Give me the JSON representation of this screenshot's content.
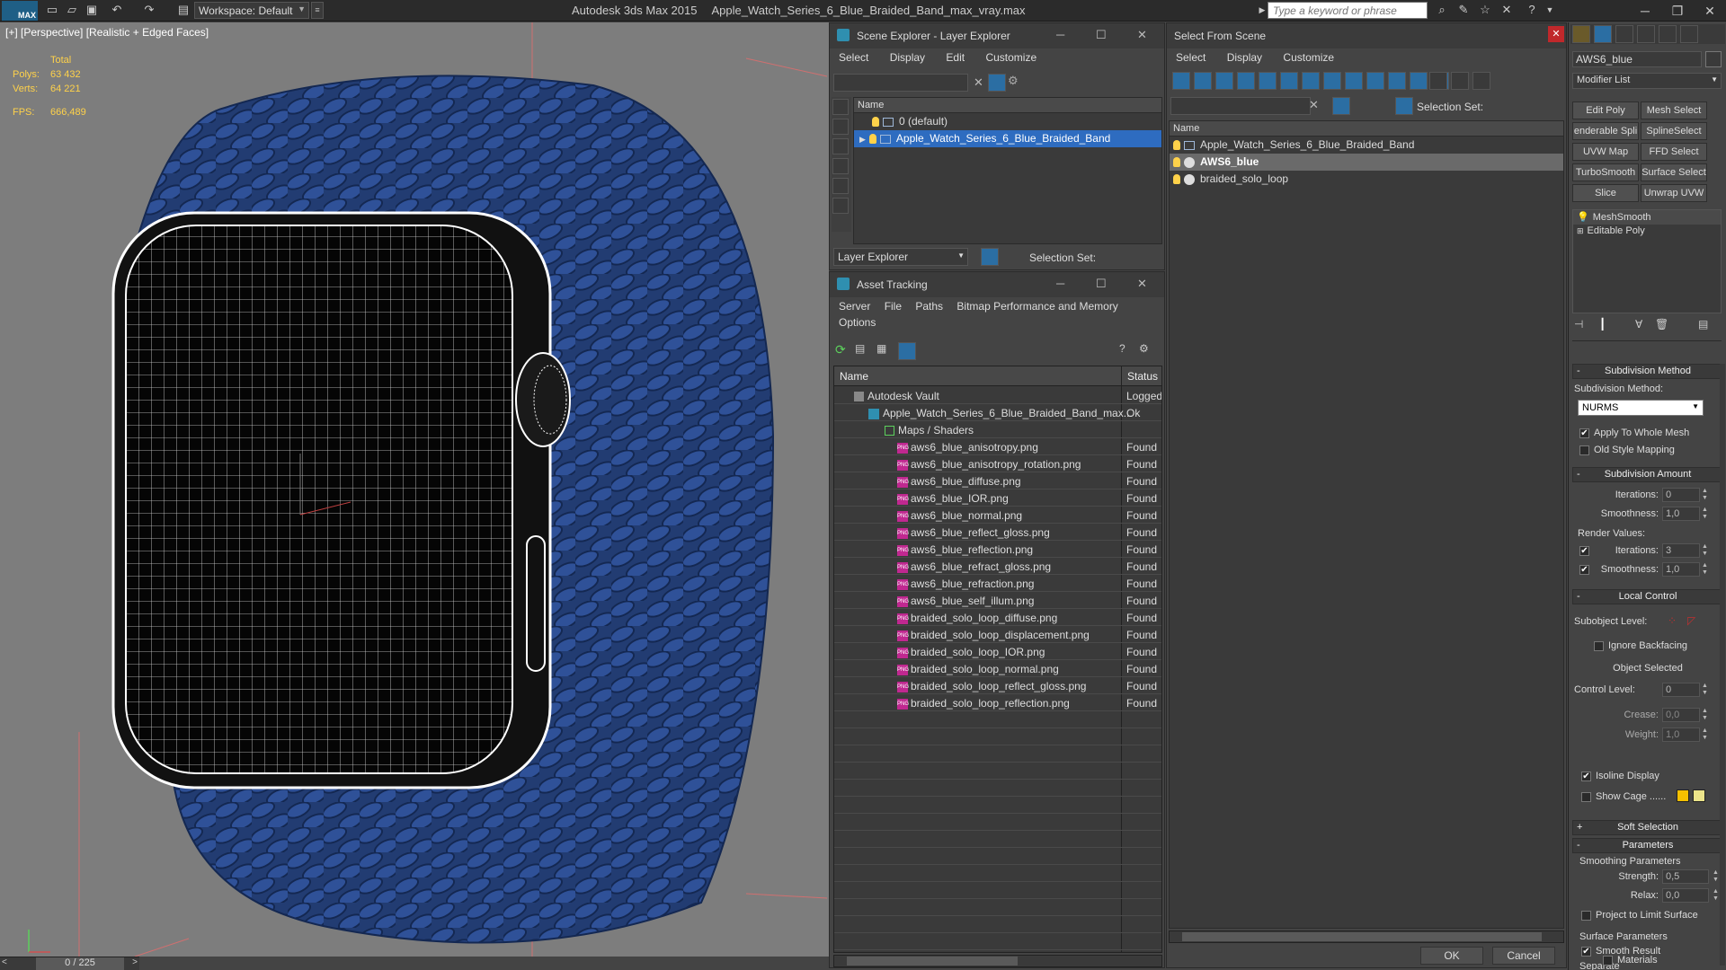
{
  "app": {
    "logo": "MAX",
    "workspace": "Workspace: Default",
    "name": "Autodesk 3ds Max  2015",
    "file": "Apple_Watch_Series_6_Blue_Braided_Band_max_vray.max",
    "search_placeholder": "Type a keyword or phrase"
  },
  "viewport": {
    "label": "[+] [Perspective] [Realistic + Edged Faces]",
    "stats": {
      "total": "Total",
      "polys_label": "Polys:",
      "polys": "63 432",
      "verts_label": "Verts:",
      "verts": "64 221",
      "fps_label": "FPS:",
      "fps": "666,489"
    },
    "timeline": {
      "frame": "0 / 225",
      "left": "<",
      "right": ">"
    }
  },
  "scene_explorer": {
    "title": "Scene Explorer - Layer Explorer",
    "menu": [
      "Select",
      "Display",
      "Edit",
      "Customize"
    ],
    "col_name": "Name",
    "rows": [
      "0 (default)",
      "Apple_Watch_Series_6_Blue_Braided_Band"
    ],
    "footer_dropdown": "Layer Explorer",
    "selection_set": "Selection Set:"
  },
  "asset_tracking": {
    "title": "Asset Tracking",
    "menu": [
      "Server",
      "File",
      "Paths",
      "Bitmap Performance and Memory"
    ],
    "menu2": "Options",
    "col_name": "Name",
    "col_status": "Status",
    "rows": [
      {
        "name": "Autodesk Vault",
        "status": "Logged",
        "level": 1,
        "icon": "vault"
      },
      {
        "name": "Apple_Watch_Series_6_Blue_Braided_Band_max...",
        "status": "Ok",
        "level": 2,
        "icon": "max"
      },
      {
        "name": "Maps / Shaders",
        "status": "",
        "level": 3,
        "icon": "folder"
      },
      {
        "name": "aws6_blue_anisotropy.png",
        "status": "Found",
        "level": 4,
        "icon": "png"
      },
      {
        "name": "aws6_blue_anisotropy_rotation.png",
        "status": "Found",
        "level": 4,
        "icon": "png"
      },
      {
        "name": "aws6_blue_diffuse.png",
        "status": "Found",
        "level": 4,
        "icon": "png"
      },
      {
        "name": "aws6_blue_IOR.png",
        "status": "Found",
        "level": 4,
        "icon": "png"
      },
      {
        "name": "aws6_blue_normal.png",
        "status": "Found",
        "level": 4,
        "icon": "png"
      },
      {
        "name": "aws6_blue_reflect_gloss.png",
        "status": "Found",
        "level": 4,
        "icon": "png"
      },
      {
        "name": "aws6_blue_reflection.png",
        "status": "Found",
        "level": 4,
        "icon": "png"
      },
      {
        "name": "aws6_blue_refract_gloss.png",
        "status": "Found",
        "level": 4,
        "icon": "png"
      },
      {
        "name": "aws6_blue_refraction.png",
        "status": "Found",
        "level": 4,
        "icon": "png"
      },
      {
        "name": "aws6_blue_self_illum.png",
        "status": "Found",
        "level": 4,
        "icon": "png"
      },
      {
        "name": "braided_solo_loop_diffuse.png",
        "status": "Found",
        "level": 4,
        "icon": "png"
      },
      {
        "name": "braided_solo_loop_displacement.png",
        "status": "Found",
        "level": 4,
        "icon": "png"
      },
      {
        "name": "braided_solo_loop_IOR.png",
        "status": "Found",
        "level": 4,
        "icon": "png"
      },
      {
        "name": "braided_solo_loop_normal.png",
        "status": "Found",
        "level": 4,
        "icon": "png"
      },
      {
        "name": "braided_solo_loop_reflect_gloss.png",
        "status": "Found",
        "level": 4,
        "icon": "png"
      },
      {
        "name": "braided_solo_loop_reflection.png",
        "status": "Found",
        "level": 4,
        "icon": "png"
      }
    ]
  },
  "select_from_scene": {
    "title": "Select From Scene",
    "menu": [
      "Select",
      "Display",
      "Customize"
    ],
    "selection_set": "Selection Set:",
    "col_name": "Name",
    "rows": [
      {
        "name": "Apple_Watch_Series_6_Blue_Braided_Band",
        "state": "normal"
      },
      {
        "name": "AWS6_blue",
        "state": "selected"
      },
      {
        "name": "braided_solo_loop",
        "state": "normal"
      }
    ],
    "ok": "OK",
    "cancel": "Cancel"
  },
  "command_panel": {
    "object_name": "AWS6_blue",
    "modifier_list": "Modifier List",
    "buttons": [
      "Edit Poly",
      "Mesh Select",
      "enderable Spli",
      "SplineSelect",
      "UVW Map",
      "FFD Select",
      "TurboSmooth",
      "Surface Select",
      "Slice",
      "Unwrap UVW"
    ],
    "stack": [
      "MeshSmooth",
      "Editable Poly"
    ],
    "subdivision_method": {
      "title": "Subdivision Method",
      "label": "Subdivision Method:",
      "value": "NURMS",
      "apply_whole_mesh": "Apply To Whole Mesh",
      "old_style": "Old Style Mapping"
    },
    "subdivision_amount": {
      "title": "Subdivision Amount",
      "iterations_label": "Iterations:",
      "iterations": "0",
      "smoothness_label": "Smoothness:",
      "smoothness": "1,0",
      "render_values": "Render Values:",
      "r_iterations_label": "Iterations:",
      "r_iterations": "3",
      "r_smoothness_label": "Smoothness:",
      "r_smoothness": "1,0"
    },
    "local_control": {
      "title": "Local Control",
      "subobject": "Subobject Level:",
      "ignore_backfacing": "Ignore Backfacing",
      "object_selected": "Object Selected",
      "control_level_label": "Control Level:",
      "control_level": "0",
      "crease_label": "Crease:",
      "crease": "0,0",
      "weight_label": "Weight:",
      "weight": "1,0",
      "isoline": "Isoline Display",
      "show_cage": "Show Cage ......"
    },
    "soft_selection": "Soft Selection",
    "parameters": {
      "title": "Parameters",
      "smoothing": "Smoothing Parameters",
      "strength_label": "Strength:",
      "strength": "0,5",
      "relax_label": "Relax:",
      "relax": "0,0",
      "project": "Project to Limit Surface",
      "surface": "Surface Parameters",
      "smooth_result": "Smooth Result",
      "separate": "Separate",
      "materials": "Materials"
    }
  },
  "colors": {
    "band_blue": "#2a4a8a",
    "selection_blue": "#2e6cc0",
    "found_pink": "#c02890",
    "cage_yellow": "#f5c000"
  }
}
